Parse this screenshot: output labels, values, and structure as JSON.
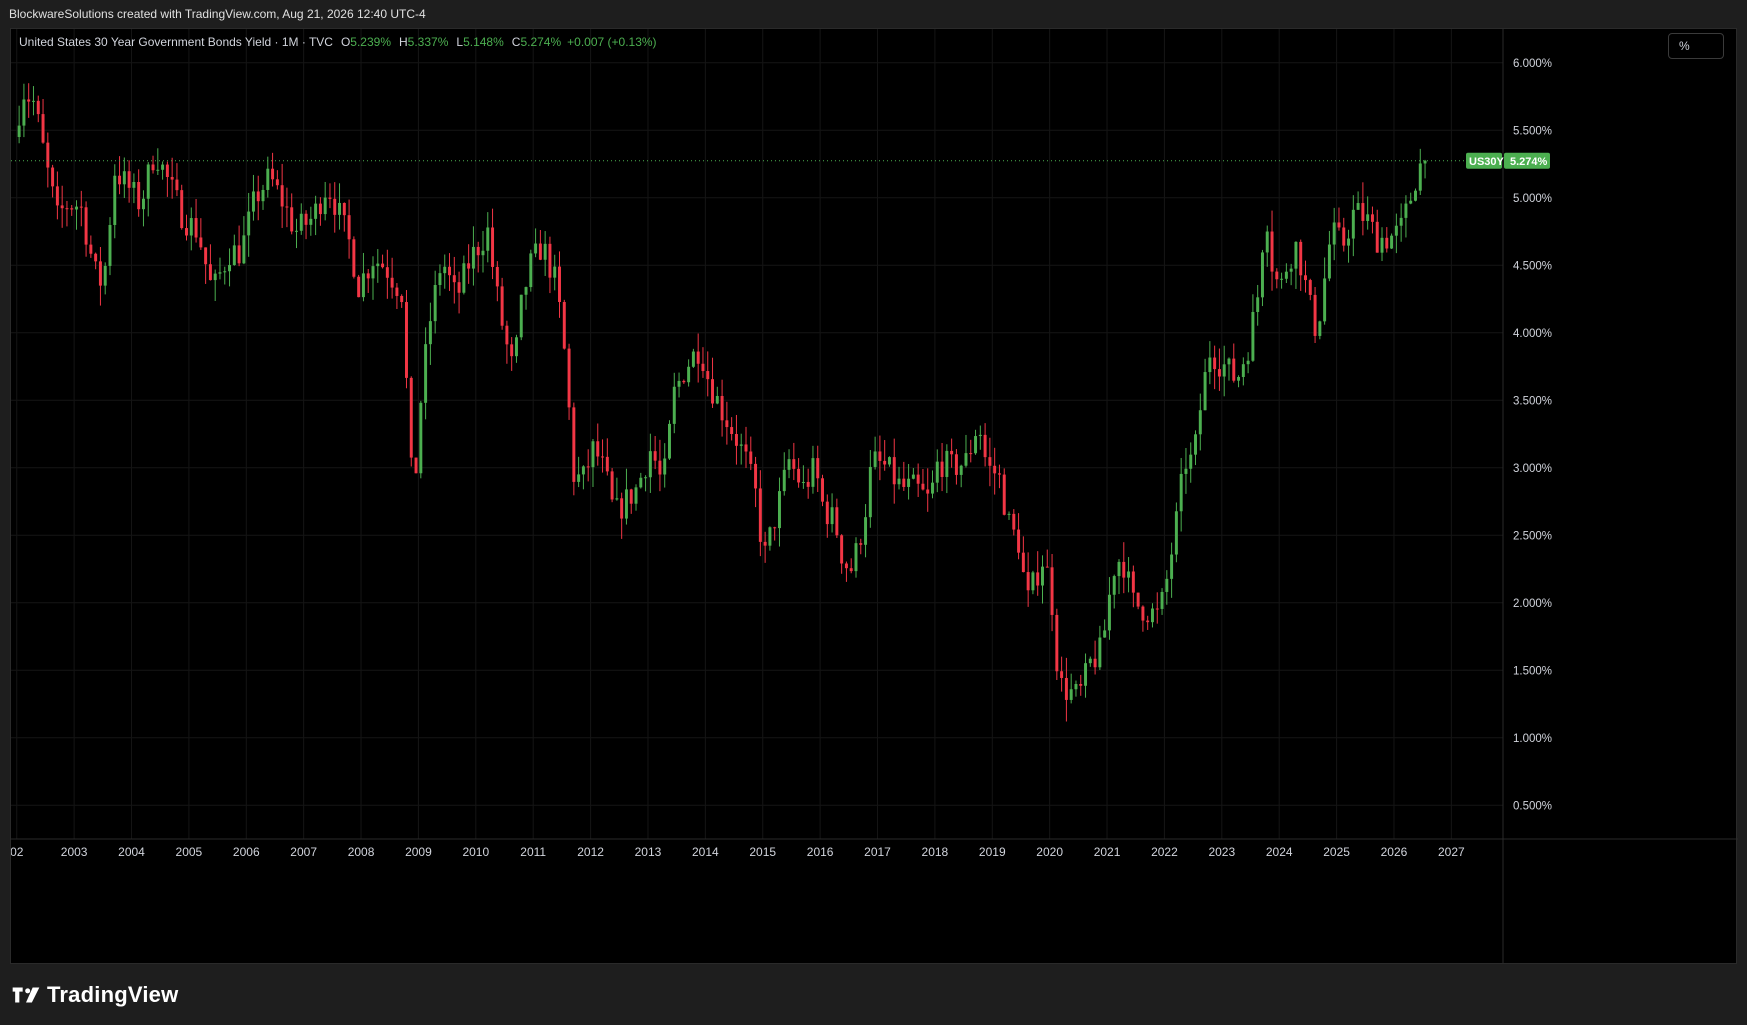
{
  "header": {
    "attribution": "BlockwareSolutions created with TradingView.com, Aug 21, 2026 12:40 UTC-4"
  },
  "legend": {
    "symbol": "United States 30 Year Government Bonds Yield · 1M · TVC",
    "open_label": "O",
    "open_value": "5.239%",
    "high_label": "H",
    "high_value": "5.337%",
    "low_label": "L",
    "low_value": "5.148%",
    "close_label": "C",
    "close_value": "5.274%",
    "change": "+0.007 (+0.13%)"
  },
  "toolbar": {
    "scale_label": "%"
  },
  "price_tag": {
    "ticker": "US30Y",
    "value": "5.274%"
  },
  "footer": {
    "brand": "TradingView"
  },
  "colors": {
    "up": "#4caf50",
    "down": "#f23645",
    "background": "#000000",
    "grid": "#151515",
    "tag": "#4caf50"
  },
  "chart_data": {
    "type": "candlestick",
    "title": "United States 30 Year Government Bonds Yield",
    "interval": "1M",
    "ylim": [
      0.25,
      6.25
    ],
    "xlim": [
      2001.9,
      2027.9
    ],
    "yticks": [
      0.5,
      1.0,
      1.5,
      2.0,
      2.5,
      3.0,
      3.5,
      4.0,
      4.5,
      5.0,
      5.5,
      6.0
    ],
    "ytick_labels": [
      "0.500%",
      "1.000%",
      "1.500%",
      "2.000%",
      "2.500%",
      "3.000%",
      "3.500%",
      "4.000%",
      "4.500%",
      "5.000%",
      "5.500%",
      "6.000%"
    ],
    "xticks": [
      2002,
      2003,
      2004,
      2005,
      2006,
      2007,
      2008,
      2009,
      2010,
      2011,
      2012,
      2013,
      2014,
      2015,
      2016,
      2017,
      2018,
      2019,
      2020,
      2021,
      2022,
      2023,
      2024,
      2025,
      2026,
      2027
    ],
    "xtick_labels": [
      "02",
      "2003",
      "2004",
      "2005",
      "2006",
      "2007",
      "2008",
      "2009",
      "2010",
      "2011",
      "2012",
      "2013",
      "2014",
      "2015",
      "2016",
      "2017",
      "2018",
      "2019",
      "2020",
      "2021",
      "2022",
      "2023",
      "2024",
      "2025",
      "2026",
      "2027"
    ],
    "last_close": 5.274,
    "grid": true,
    "anchors": [
      [
        2002.0,
        5.45
      ],
      [
        2002.15,
        5.8
      ],
      [
        2002.35,
        5.7
      ],
      [
        2002.55,
        5.25
      ],
      [
        2002.75,
        4.85
      ],
      [
        2002.9,
        4.95
      ],
      [
        2003.15,
        4.95
      ],
      [
        2003.4,
        4.45
      ],
      [
        2003.55,
        4.35
      ],
      [
        2003.75,
        5.2
      ],
      [
        2003.95,
        5.1
      ],
      [
        2004.2,
        4.95
      ],
      [
        2004.45,
        5.35
      ],
      [
        2004.6,
        5.2
      ],
      [
        2004.8,
        5.0
      ],
      [
        2004.95,
        4.85
      ],
      [
        2005.2,
        4.75
      ],
      [
        2005.45,
        4.3
      ],
      [
        2005.75,
        4.6
      ],
      [
        2005.95,
        4.6
      ],
      [
        2006.2,
        5.0
      ],
      [
        2006.45,
        5.15
      ],
      [
        2006.7,
        4.95
      ],
      [
        2006.9,
        4.75
      ],
      [
        2007.2,
        4.85
      ],
      [
        2007.45,
        5.1
      ],
      [
        2007.6,
        4.95
      ],
      [
        2007.85,
        4.65
      ],
      [
        2008.0,
        4.35
      ],
      [
        2008.25,
        4.55
      ],
      [
        2008.45,
        4.5
      ],
      [
        2008.6,
        4.4
      ],
      [
        2008.75,
        4.3
      ],
      [
        2008.85,
        3.5
      ],
      [
        2008.95,
        2.7
      ],
      [
        2009.1,
        3.6
      ],
      [
        2009.25,
        4.1
      ],
      [
        2009.45,
        4.55
      ],
      [
        2009.7,
        4.25
      ],
      [
        2009.95,
        4.55
      ],
      [
        2010.25,
        4.75
      ],
      [
        2010.4,
        4.3
      ],
      [
        2010.55,
        3.95
      ],
      [
        2010.7,
        3.7
      ],
      [
        2010.85,
        4.25
      ],
      [
        2011.0,
        4.5
      ],
      [
        2011.2,
        4.65
      ],
      [
        2011.45,
        4.35
      ],
      [
        2011.6,
        3.8
      ],
      [
        2011.75,
        2.95
      ],
      [
        2011.9,
        2.9
      ],
      [
        2012.1,
        3.15
      ],
      [
        2012.3,
        2.95
      ],
      [
        2012.45,
        2.65
      ],
      [
        2012.65,
        2.75
      ],
      [
        2012.85,
        2.85
      ],
      [
        2013.1,
        3.15
      ],
      [
        2013.3,
        2.85
      ],
      [
        2013.5,
        3.55
      ],
      [
        2013.7,
        3.75
      ],
      [
        2013.95,
        3.9
      ],
      [
        2014.1,
        3.65
      ],
      [
        2014.3,
        3.45
      ],
      [
        2014.55,
        3.25
      ],
      [
        2014.75,
        3.05
      ],
      [
        2014.95,
        2.75
      ],
      [
        2015.05,
        2.3
      ],
      [
        2015.3,
        2.7
      ],
      [
        2015.5,
        3.05
      ],
      [
        2015.75,
        2.85
      ],
      [
        2015.95,
        3.0
      ],
      [
        2016.1,
        2.7
      ],
      [
        2016.3,
        2.6
      ],
      [
        2016.45,
        2.3
      ],
      [
        2016.6,
        2.25
      ],
      [
        2016.8,
        2.6
      ],
      [
        2016.95,
        3.05
      ],
      [
        2017.2,
        3.0
      ],
      [
        2017.45,
        2.85
      ],
      [
        2017.7,
        2.85
      ],
      [
        2017.95,
        2.75
      ],
      [
        2018.1,
        3.05
      ],
      [
        2018.35,
        3.0
      ],
      [
        2018.6,
        3.05
      ],
      [
        2018.8,
        3.35
      ],
      [
        2018.95,
        3.0
      ],
      [
        2019.15,
        2.95
      ],
      [
        2019.35,
        2.55
      ],
      [
        2019.5,
        2.45
      ],
      [
        2019.65,
        2.0
      ],
      [
        2019.85,
        2.25
      ],
      [
        2019.95,
        2.35
      ],
      [
        2020.1,
        1.95
      ],
      [
        2020.2,
        1.4
      ],
      [
        2020.35,
        1.35
      ],
      [
        2020.55,
        1.3
      ],
      [
        2020.75,
        1.55
      ],
      [
        2020.95,
        1.65
      ],
      [
        2021.15,
        2.25
      ],
      [
        2021.3,
        2.35
      ],
      [
        2021.5,
        2.0
      ],
      [
        2021.7,
        1.95
      ],
      [
        2021.95,
        1.9
      ],
      [
        2022.1,
        2.2
      ],
      [
        2022.25,
        2.6
      ],
      [
        2022.4,
        3.05
      ],
      [
        2022.55,
        3.05
      ],
      [
        2022.7,
        3.55
      ],
      [
        2022.85,
        3.9
      ],
      [
        2022.95,
        3.8
      ],
      [
        2023.1,
        3.75
      ],
      [
        2023.3,
        3.65
      ],
      [
        2023.5,
        3.9
      ],
      [
        2023.7,
        4.35
      ],
      [
        2023.8,
        5.0
      ],
      [
        2023.9,
        4.55
      ],
      [
        2024.05,
        4.3
      ],
      [
        2024.2,
        4.55
      ],
      [
        2024.35,
        4.65
      ],
      [
        2024.6,
        4.15
      ],
      [
        2024.7,
        4.0
      ],
      [
        2024.85,
        4.45
      ],
      [
        2024.95,
        4.75
      ],
      [
        2025.15,
        4.65
      ],
      [
        2025.35,
        4.9
      ],
      [
        2025.55,
        4.85
      ],
      [
        2025.75,
        4.7
      ],
      [
        2025.95,
        4.7
      ],
      [
        2026.15,
        4.75
      ],
      [
        2026.3,
        4.95
      ],
      [
        2026.45,
        5.2
      ],
      [
        2026.55,
        5.274
      ]
    ]
  }
}
